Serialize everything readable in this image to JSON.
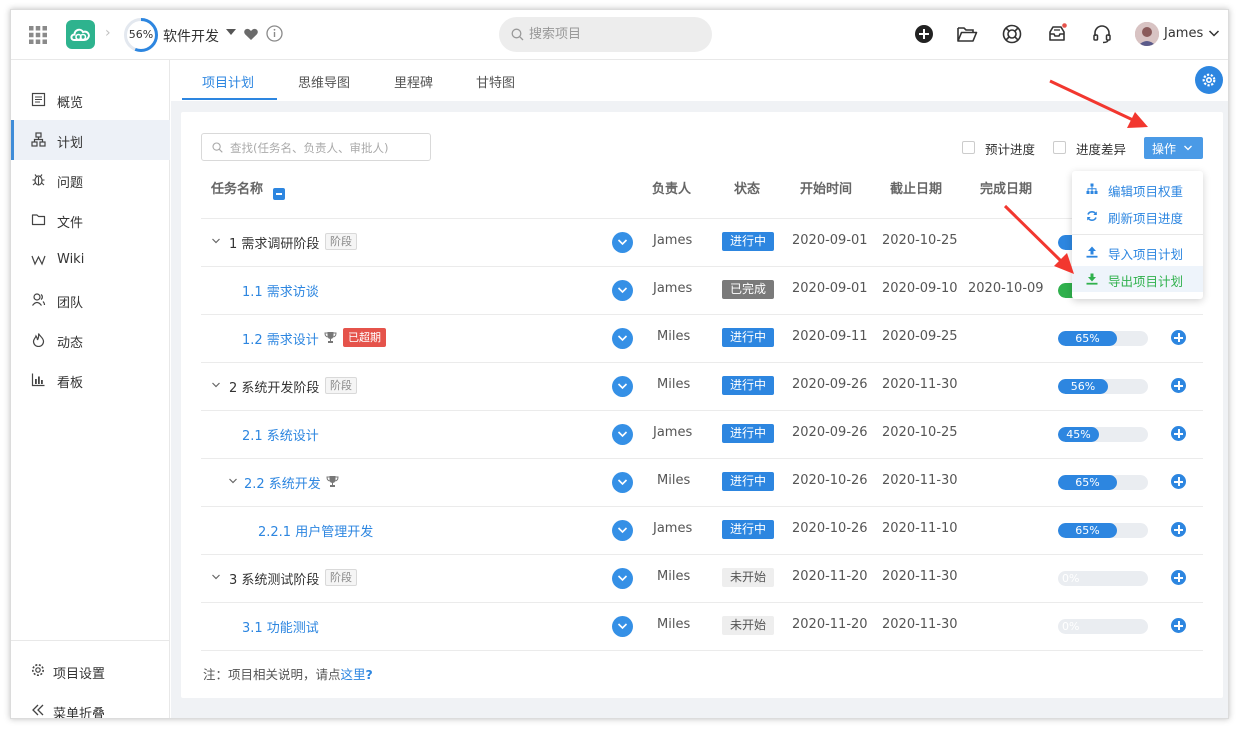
{
  "header": {
    "project_progress": "56%",
    "project_name": "软件开发",
    "search_placeholder": "搜索项目",
    "user_name": "James"
  },
  "sidebar": {
    "items": [
      {
        "label": "概览",
        "icon": "overview-icon"
      },
      {
        "label": "计划",
        "icon": "plan-icon",
        "active": true
      },
      {
        "label": "问题",
        "icon": "bug-icon"
      },
      {
        "label": "文件",
        "icon": "folder-icon"
      },
      {
        "label": "Wiki",
        "icon": "wiki-icon"
      },
      {
        "label": "团队",
        "icon": "team-icon"
      },
      {
        "label": "动态",
        "icon": "activity-icon"
      },
      {
        "label": "看板",
        "icon": "board-icon"
      }
    ],
    "settings_label": "项目设置",
    "collapse_label": "菜单折叠"
  },
  "tabs": [
    {
      "label": "项目计划",
      "active": true
    },
    {
      "label": "思维导图"
    },
    {
      "label": "里程碑"
    },
    {
      "label": "甘特图"
    }
  ],
  "toolbar": {
    "filter_placeholder": "查找(任务名、负责人、审批人)",
    "planned_progress_label": "预计进度",
    "progress_diff_label": "进度差异",
    "operation_label": "操作"
  },
  "dropdown": {
    "items": [
      {
        "label": "编辑项目权重",
        "icon": "sitemap-icon"
      },
      {
        "label": "刷新项目进度",
        "icon": "refresh-icon"
      },
      {
        "label": "导入项目计划",
        "icon": "upload-icon"
      },
      {
        "label": "导出项目计划",
        "icon": "download-icon",
        "hover": true
      }
    ]
  },
  "table": {
    "columns": [
      "任务名称",
      "负责人",
      "状态",
      "开始时间",
      "截止日期",
      "完成日期"
    ],
    "rows": [
      {
        "name": "1 需求调研阶段",
        "tag": "阶段",
        "owner": "James",
        "status": "进行中",
        "start": "2020-09-01",
        "due": "2020-10-25",
        "finish": "",
        "progress": 0.25,
        "progress_label": ""
      },
      {
        "name": "1.1 需求访谈",
        "owner": "James",
        "status": "已完成",
        "start": "2020-09-01",
        "due": "2020-09-10",
        "finish": "2020-10-09",
        "progress": 1,
        "progress_label": ""
      },
      {
        "name": "1.2 需求设计",
        "overdue": "已超期",
        "owner": "Miles",
        "status": "进行中",
        "start": "2020-09-11",
        "due": "2020-09-25",
        "finish": "",
        "progress": 0.65,
        "progress_label": "65%"
      },
      {
        "name": "2 系统开发阶段",
        "tag": "阶段",
        "owner": "Miles",
        "status": "进行中",
        "start": "2020-09-26",
        "due": "2020-11-30",
        "finish": "",
        "progress": 0.56,
        "progress_label": "56%"
      },
      {
        "name": "2.1 系统设计",
        "owner": "James",
        "status": "进行中",
        "start": "2020-09-26",
        "due": "2020-10-25",
        "finish": "",
        "progress": 0.45,
        "progress_label": "45%"
      },
      {
        "name": "2.2 系统开发",
        "owner": "Miles",
        "status": "进行中",
        "start": "2020-10-26",
        "due": "2020-11-30",
        "finish": "",
        "progress": 0.65,
        "progress_label": "65%"
      },
      {
        "name": "2.2.1 用户管理开发",
        "owner": "James",
        "status": "进行中",
        "start": "2020-10-26",
        "due": "2020-11-10",
        "finish": "",
        "progress": 0.65,
        "progress_label": "65%"
      },
      {
        "name": "3 系统测试阶段",
        "tag": "阶段",
        "owner": "Miles",
        "status": "未开始",
        "start": "2020-11-20",
        "due": "2020-11-30",
        "finish": "",
        "progress": 0,
        "progress_label": "0%"
      },
      {
        "name": "3.1 功能测试",
        "owner": "Miles",
        "status": "未开始",
        "start": "2020-11-20",
        "due": "2020-11-30",
        "finish": "",
        "progress": 0,
        "progress_label": "0%"
      }
    ]
  },
  "note": {
    "prefix": "注：项目相关说明，请点",
    "link": "这里",
    "suffix": "?"
  }
}
